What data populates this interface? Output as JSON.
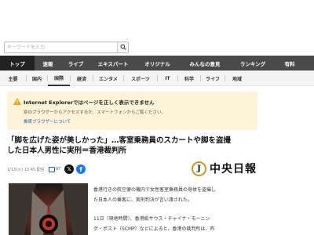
{
  "search": {
    "placeholder": "キーワードを入力"
  },
  "global_nav": [
    {
      "label": "トップ",
      "active": true
    },
    {
      "label": "速報"
    },
    {
      "label": "ライブ"
    },
    {
      "label": "エキスパート"
    },
    {
      "label": "オリジナル"
    },
    {
      "label": "みんなの意見"
    },
    {
      "label": "ランキング"
    },
    {
      "label": "有料"
    }
  ],
  "sub_nav": [
    {
      "label": "主要"
    },
    {
      "label": "国内"
    },
    {
      "label": "国際",
      "active": true
    },
    {
      "label": "経済"
    },
    {
      "label": "エンタメ"
    },
    {
      "label": "スポーツ"
    },
    {
      "label": "IT"
    },
    {
      "label": "科学"
    },
    {
      "label": "ライフ"
    },
    {
      "label": "地域"
    }
  ],
  "notice": {
    "title": "Internet Explorerではページを正しく表示できません",
    "text": "別のブラウザーからアクセスするか、スマートフォンからご覧ください。",
    "link": "推奨ブラウザーについて"
  },
  "article": {
    "headline_lines": [
      "「脚を広げた姿が美しかった」…客室乗務員のスカートや脚を盗撮",
      "した日本人男性に実刑＝香港裁判所"
    ],
    "date": "1/13(火) 13:45 配信",
    "comment_count": "97",
    "source_logo_mark": "J",
    "source_name": "中央日報",
    "body_lines": [
      "香港行きの航空便の機内で女性客室乗務員の身体を盗撮し",
      "た日本人の乗客に、実刑判決が言い渡された。",
      "11日（現地時間）、香港紙サウス・チャイナ・モーニン",
      "グ・ポスト（SCMP）などによると、香港の裁判所は、昨"
    ]
  },
  "colors": {
    "global_nav_bg": "#4a4a4a",
    "global_nav_active": "#222222",
    "notice_bg": "#fdf3d8",
    "link": "#2a5db0",
    "warning": "#e8a317"
  },
  "icons": {
    "search": "search-icon",
    "warning": "warning-icon",
    "comment": "comment-icon",
    "x": "x-share-icon",
    "facebook": "facebook-share-icon"
  }
}
